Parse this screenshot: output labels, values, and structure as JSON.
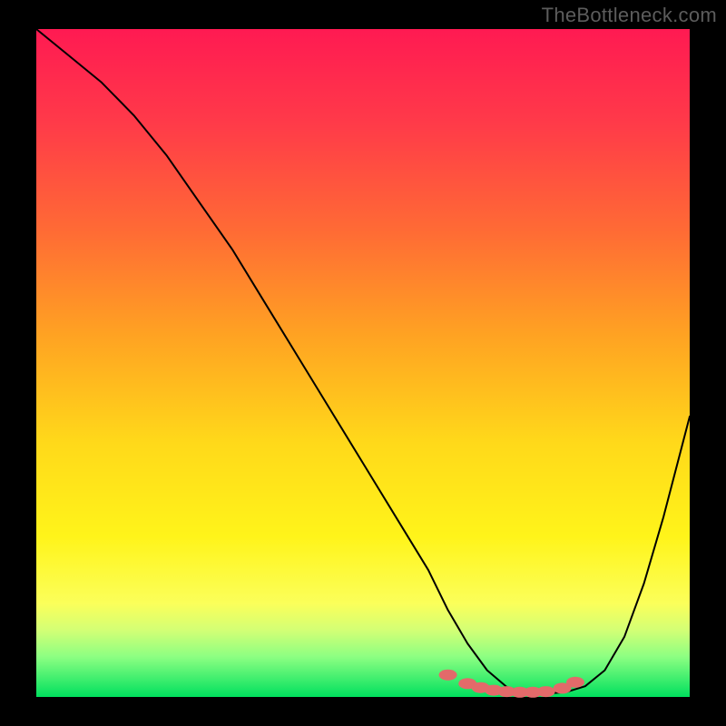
{
  "watermark": "TheBottleneck.com",
  "chart_data": {
    "type": "line",
    "title": "",
    "xlabel": "",
    "ylabel": "",
    "xlim": [
      0,
      100
    ],
    "ylim": [
      0,
      100
    ],
    "series": [
      {
        "name": "curve",
        "x": [
          0,
          5,
          10,
          15,
          20,
          25,
          30,
          35,
          40,
          45,
          50,
          55,
          60,
          63,
          66,
          69,
          72,
          75,
          78,
          81,
          84,
          87,
          90,
          93,
          96,
          100
        ],
        "values": [
          100,
          96,
          92,
          87,
          81,
          74,
          67,
          59,
          51,
          43,
          35,
          27,
          19,
          13,
          8,
          4,
          1.5,
          0.6,
          0.5,
          0.7,
          1.6,
          4,
          9,
          17,
          27,
          42
        ]
      }
    ],
    "markers": {
      "name": "low-band",
      "color": "#e36a6a",
      "x": [
        63,
        66,
        68,
        70,
        72,
        74,
        76,
        78,
        80.5,
        82.5
      ],
      "values": [
        3.3,
        2.0,
        1.4,
        1.0,
        0.8,
        0.7,
        0.7,
        0.8,
        1.3,
        2.2
      ]
    }
  }
}
